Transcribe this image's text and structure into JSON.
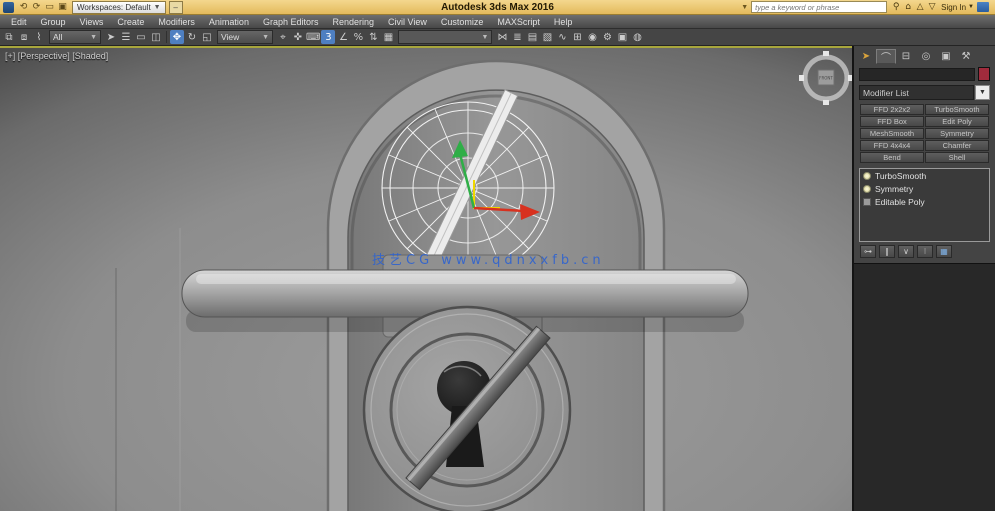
{
  "title_bar": {
    "bg_color": "#eac873",
    "title": "Autodesk 3ds Max 2016",
    "workspaces_label": "Workspaces: Default",
    "search_placeholder": "type a keyword or phrase",
    "sign_in_label": "Sign In",
    "quick_access_icons": [
      {
        "name": "undo-icon",
        "glyph": "⟲"
      },
      {
        "name": "redo-icon",
        "glyph": "⟳"
      },
      {
        "name": "open-file-icon",
        "glyph": "▭"
      },
      {
        "name": "project-folder-icon",
        "glyph": "▣"
      }
    ],
    "right_icons": [
      {
        "name": "search-icon",
        "glyph": "⚲"
      },
      {
        "name": "home-icon",
        "glyph": "⌂"
      },
      {
        "name": "upload-cloud-icon",
        "glyph": "△"
      },
      {
        "name": "download-cloud-icon",
        "glyph": "▽"
      }
    ]
  },
  "menu_bar": {
    "items": [
      "Edit",
      "Group",
      "Views",
      "Create",
      "Modifiers",
      "Animation",
      "Graph Editors",
      "Rendering",
      "Civil View",
      "Customize",
      "MAXScript",
      "Help"
    ]
  },
  "toolbar": {
    "selection_filter_value": "All",
    "reference_coordinate_value": "View",
    "named_selection_sets_value": "",
    "group_link": [
      {
        "name": "select-and-link-icon",
        "glyph": "⧉"
      },
      {
        "name": "unlink-selection-icon",
        "glyph": "⧈"
      },
      {
        "name": "bind-to-space-warp-icon",
        "glyph": "⌇"
      }
    ],
    "group_select": [
      {
        "name": "select-object-icon",
        "glyph": "➤"
      },
      {
        "name": "select-by-name-icon",
        "glyph": "☰"
      },
      {
        "name": "rectangular-selection-icon",
        "glyph": "▭"
      },
      {
        "name": "window-crossing-icon",
        "glyph": "◫"
      }
    ],
    "group_transform": [
      {
        "name": "select-and-move-icon",
        "glyph": "✥",
        "active": true
      },
      {
        "name": "select-and-rotate-icon",
        "glyph": "↻"
      },
      {
        "name": "select-and-scale-icon",
        "glyph": "◱"
      }
    ],
    "group_snap": [
      {
        "name": "use-pivot-point-icon",
        "glyph": "⌖"
      },
      {
        "name": "select-and-manipulate-icon",
        "glyph": "✜"
      },
      {
        "name": "keyboard-override-icon",
        "glyph": "⌨"
      },
      {
        "name": "snaps-toggle-icon",
        "glyph": "3",
        "active": true
      },
      {
        "name": "angle-snap-icon",
        "glyph": "∠"
      },
      {
        "name": "percent-snap-icon",
        "glyph": "%"
      },
      {
        "name": "spinner-snap-icon",
        "glyph": "⇅"
      },
      {
        "name": "edit-named-selection-sets-icon",
        "glyph": "▦"
      }
    ],
    "group_render": [
      {
        "name": "mirror-icon",
        "glyph": "⋈"
      },
      {
        "name": "align-icon",
        "glyph": "≣"
      },
      {
        "name": "layer-explorer-icon",
        "glyph": "▤"
      },
      {
        "name": "graphite-ribbon-icon",
        "glyph": "▧"
      },
      {
        "name": "curve-editor-icon",
        "glyph": "∿"
      },
      {
        "name": "schematic-view-icon",
        "glyph": "⊞"
      },
      {
        "name": "material-editor-icon",
        "glyph": "◉"
      },
      {
        "name": "render-setup-icon",
        "glyph": "⚙"
      },
      {
        "name": "rendered-frame-icon",
        "glyph": "▣"
      },
      {
        "name": "render-production-icon",
        "glyph": "◍"
      }
    ]
  },
  "viewport": {
    "label": "[+] [Perspective] [Shaded]",
    "watermark_text": "技艺CG www.qdnxxfb.cn",
    "watermark_color": "#2f63d0",
    "viewcube_face_label": "FRONT",
    "active_border_color": "#a8a63c",
    "gizmo": {
      "x_color": "#d8311f",
      "y_color": "#2fae47",
      "highlight_color": "#f0d800"
    }
  },
  "command_panel": {
    "tabs": [
      {
        "name": "tab-create",
        "glyph": "➤"
      },
      {
        "name": "tab-modify",
        "glyph": "⌒",
        "active": true
      },
      {
        "name": "tab-hierarchy",
        "glyph": "⊟"
      },
      {
        "name": "tab-motion",
        "glyph": "◎"
      },
      {
        "name": "tab-display",
        "glyph": "▣"
      },
      {
        "name": "tab-utilities",
        "glyph": "⚒"
      }
    ],
    "object_name_value": "",
    "object_color_swatch": "#a12b3c",
    "modifier_list_label": "Modifier List",
    "modifier_buttons": [
      "FFD 2x2x2",
      "TurboSmooth",
      "FFD Box",
      "Edit Poly",
      "MeshSmooth",
      "Symmetry",
      "FFD 4x4x4",
      "Chamfer",
      "Bend",
      "Shell"
    ],
    "modifier_stack": [
      {
        "name": "stack-item-turbosmooth",
        "label": "TurboSmooth",
        "icon": "icon-bulb"
      },
      {
        "name": "stack-item-symmetry",
        "label": "Symmetry",
        "icon": "icon-bulb"
      },
      {
        "name": "stack-item-editable-poly",
        "label": "Editable Poly",
        "icon": "icon-poly"
      }
    ],
    "stack_toolbar": [
      {
        "name": "pin-stack-button",
        "glyph": "⊶"
      },
      {
        "name": "show-end-result-button",
        "glyph": "∥"
      },
      {
        "name": "make-unique-button",
        "glyph": "∨"
      },
      {
        "name": "remove-modifier-button",
        "glyph": "⁝"
      },
      {
        "name": "configure-modifier-sets-button",
        "glyph": "▦",
        "accent": true
      }
    ]
  }
}
